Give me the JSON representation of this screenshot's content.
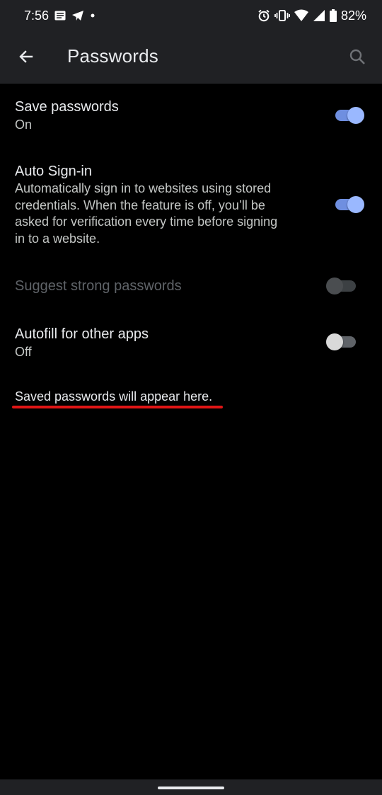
{
  "status_bar": {
    "time": "7:56",
    "battery": "82%",
    "left_icons": [
      "news-icon",
      "telegram-icon",
      "dot-icon"
    ],
    "right_icons": [
      "alarm-icon",
      "vibrate-icon",
      "wifi-icon",
      "signal-icon",
      "battery-icon"
    ]
  },
  "app_bar": {
    "title": "Passwords",
    "back_icon": "arrow-back-icon",
    "search_icon": "search-icon"
  },
  "settings": {
    "save_passwords": {
      "title": "Save passwords",
      "subtitle": "On",
      "enabled": true
    },
    "auto_signin": {
      "title": "Auto Sign-in",
      "desc_lines": [
        "Automatically sign in to websites using stored",
        "credentials. When the feature is off, you’ll be",
        "asked for verification every time before signing",
        "in to a website."
      ],
      "enabled": true
    },
    "suggest_strong": {
      "title": "Suggest strong passwords",
      "enabled": false,
      "disabled": true
    },
    "autofill_other_apps": {
      "title": "Autofill for other apps",
      "subtitle": "Off",
      "enabled": false
    }
  },
  "empty_state": {
    "message": "Saved passwords will appear here."
  },
  "colors": {
    "background": "#000000",
    "app_bar": "#202124",
    "toggle_on": "#9ab8ff",
    "underline": "#e01515"
  }
}
